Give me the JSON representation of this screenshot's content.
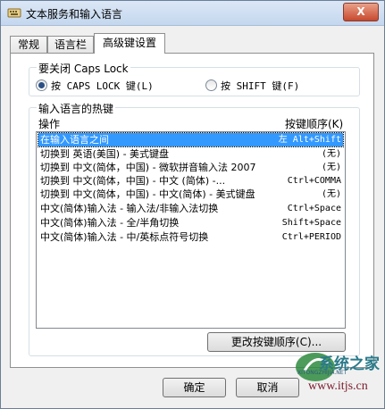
{
  "window": {
    "title": "文本服务和输入语言",
    "close_label": "X"
  },
  "tabs": [
    {
      "label": "常规",
      "active": false
    },
    {
      "label": "语言栏",
      "active": false
    },
    {
      "label": "高级键设置",
      "active": true
    }
  ],
  "caps_lock": {
    "group_label": "要关闭 Caps Lock",
    "options": [
      {
        "label": "按 CAPS LOCK 键(L)",
        "selected": true
      },
      {
        "label": "按 SHIFT 键(F)",
        "selected": false
      }
    ]
  },
  "hotkeys": {
    "group_label": "输入语言的热键",
    "col_action": "操作",
    "col_sequence": "按键顺序(K)",
    "rows": [
      {
        "action": "在输入语言之间",
        "keys": "左 Alt+Shift",
        "selected": true
      },
      {
        "action": "切换到 英语(美国) - 美式键盘",
        "keys": "(无)",
        "selected": false
      },
      {
        "action": "切换到 中文(简体，中国) - 微软拼音输入法 2007",
        "keys": "(无)",
        "selected": false
      },
      {
        "action": "切换到 中文(简体，中国) - 中文 (简体) -...",
        "keys": "Ctrl+COMMA",
        "selected": false
      },
      {
        "action": "切换到 中文(简体，中国) - 中文(简体) - 美式键盘",
        "keys": "(无)",
        "selected": false
      },
      {
        "action": "中文(简体)输入法 - 输入法/非输入法切换",
        "keys": "Ctrl+Space",
        "selected": false
      },
      {
        "action": "中文(简体)输入法 - 全/半角切换",
        "keys": "Shift+Space",
        "selected": false
      },
      {
        "action": "中文(简体)输入法 - 中/英标点符号切换",
        "keys": "Ctrl+PERIOD",
        "selected": false
      }
    ],
    "change_button": "更改按键顺序(C)..."
  },
  "footer": {
    "ok_label": "确定",
    "cancel_label": "取消"
  },
  "watermark": {
    "name": "系统之家",
    "url": "XITONGZHIJIA.NET",
    "site": "www.itjs.cn"
  }
}
